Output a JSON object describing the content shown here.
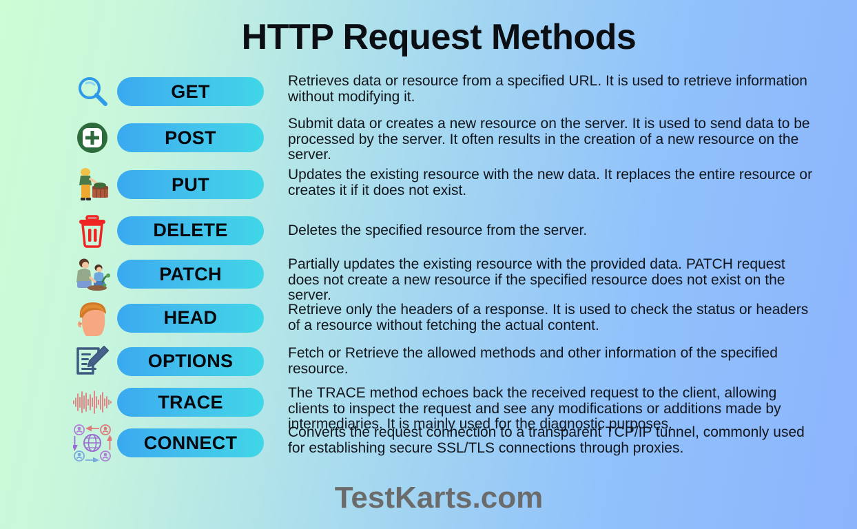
{
  "title": "HTTP Request Methods",
  "footer": "TestKarts.com",
  "colors": {
    "bg_start": "#ccfdd4",
    "bg_end": "#8cb4fc",
    "pill_start": "#3aa9ef",
    "pill_end": "#40d6e7",
    "title_text": "#0b0f14",
    "body_text": "#12161c",
    "footer_text": "#6b6b6b"
  },
  "methods": [
    {
      "name": "GET",
      "icon": "magnifying-glass-icon",
      "description": "Retrieves data or resource from a specified URL. It is used to retrieve information without modifying it."
    },
    {
      "name": "POST",
      "icon": "circle-plus-icon",
      "description": "Submit data or creates a new resource on the server. It is used to send data to be processed by the server. It often results in the creation of a new resource on the server."
    },
    {
      "name": "PUT",
      "icon": "person-with-basket-icon",
      "description": "Updates the existing resource with the new data. It replaces the entire resource or creates it if it does not exist."
    },
    {
      "name": "DELETE",
      "icon": "trash-can-icon",
      "description": "Deletes the specified resource from the server."
    },
    {
      "name": "PATCH",
      "icon": "people-gardening-icon",
      "description": "Partially updates the existing resource with the provided data. PATCH request does not create a new resource if the specified resource does not exist on the server."
    },
    {
      "name": "HEAD",
      "icon": "head-profile-icon",
      "description": "Retrieve only the headers of a response. It is used to check the status or headers of a resource without fetching the actual content."
    },
    {
      "name": "OPTIONS",
      "icon": "document-pencil-icon",
      "description": "Fetch or Retrieve the allowed methods and other information of the specified resource."
    },
    {
      "name": "TRACE",
      "icon": "audio-waveform-icon",
      "description": "The TRACE method echoes back the received request to the client, allowing clients to inspect the request and see any modifications or additions made by intermediaries. It is mainly used for the diagnostic purposes."
    },
    {
      "name": "CONNECT",
      "icon": "globe-network-users-icon",
      "description": "Converts the request connection to a transparent TCP/IP tunnel, commonly used for establishing secure SSL/TLS connections through proxies."
    }
  ]
}
